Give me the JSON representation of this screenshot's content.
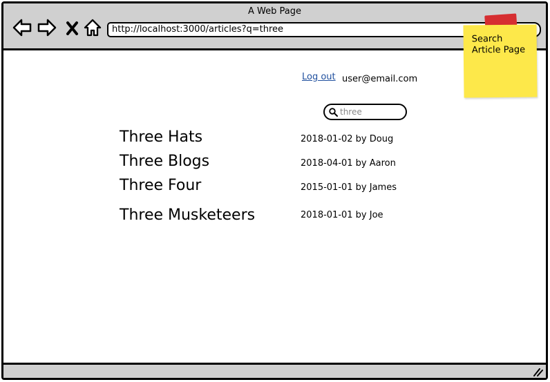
{
  "window": {
    "title": "A Web Page"
  },
  "toolbar": {
    "back_icon": "back-arrow-icon",
    "forward_icon": "forward-arrow-icon",
    "stop_icon": "close-icon",
    "home_icon": "home-icon",
    "url": "http://localhost:3000/articles?q=three"
  },
  "sticky_note": {
    "text": "Search Article Page",
    "color": "#fde84a",
    "tape_color": "#d62e31"
  },
  "header": {
    "logout_label": "Log out",
    "user_email": "user@email.com"
  },
  "search": {
    "value": "three"
  },
  "results": [
    {
      "title": "Three Hats",
      "meta": "2018-01-02 by Doug"
    },
    {
      "title": "Three Blogs",
      "meta": "2018-04-01 by Aaron"
    },
    {
      "title": "Three Four",
      "meta": "2015-01-01 by James"
    },
    {
      "title": "Three Musketeers",
      "meta": "2018-01-01 by Joe"
    }
  ],
  "colors": {
    "chrome": "#d0d0d0",
    "link": "#1f4f9e"
  }
}
